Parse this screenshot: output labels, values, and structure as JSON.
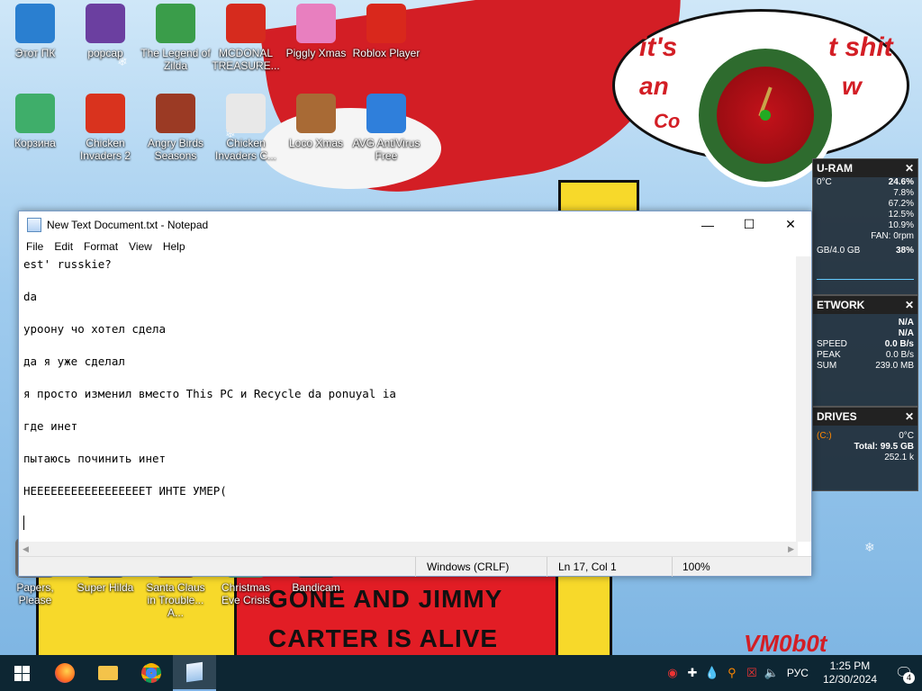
{
  "wallpaper": {
    "bubble_line1": "it's",
    "bubble_line2": "t shit",
    "bubble_line3": "an",
    "bubble_line4": "w",
    "bubble_line5": "Co",
    "shirt_line1": "GONE AND JIMMY",
    "shirt_line2": "CARTER IS ALIVE",
    "signature": "VM0b0t"
  },
  "desktop_icons": [
    {
      "label": "Этот ПК",
      "icon": "computer-icon"
    },
    {
      "label": "popcap",
      "icon": "popcap-icon"
    },
    {
      "label": "The Legend of Zilda",
      "icon": "zelda-game-icon"
    },
    {
      "label": "MCDONAL TREASURE...",
      "icon": "mcdonalds-game-icon"
    },
    {
      "label": "Piggly Xmas",
      "icon": "piggly-game-icon"
    },
    {
      "label": "Roblox Player",
      "icon": "roblox-icon"
    },
    {
      "label": "Корзина",
      "icon": "recycle-bin-icon"
    },
    {
      "label": "Chicken Invaders 2",
      "icon": "chicken-invaders-icon"
    },
    {
      "label": "Angry Birds Seasons",
      "icon": "angry-birds-icon"
    },
    {
      "label": "Chicken Invaders C...",
      "icon": "chicken-invaders-icon"
    },
    {
      "label": "Loco Xmas",
      "icon": "loco-game-icon"
    },
    {
      "label": "AVG AntiVirus Free",
      "icon": "avg-antivirus-icon"
    },
    {
      "label": "Papers, Please",
      "icon": "game-icon"
    },
    {
      "label": "Super Hilda",
      "icon": "game-icon"
    },
    {
      "label": "Santa Claus in Trouble... A...",
      "icon": "game-icon"
    },
    {
      "label": "Christmas Eve Crisis",
      "icon": "game-icon"
    },
    {
      "label": "Bandicam",
      "icon": "bandicam-icon"
    }
  ],
  "gadgets": {
    "ram": {
      "title": "U-RAM",
      "temp": "0°C",
      "cpu": "24.6%",
      "c1": "7.8%",
      "c2": "67.2%",
      "c3": "12.5%",
      "c4": "10.9%",
      "fan": "FAN: 0rpm",
      "mem": "GB/4.0 GB",
      "mem_pct": "38%"
    },
    "network": {
      "title": "ETWORK",
      "v1": "N/A",
      "v2": "N/A",
      "speed_label": "SPEED",
      "speed": "0.0 B/s",
      "peak_label": "PEAK",
      "peak": "0.0 B/s",
      "sum_label": "SUM",
      "sum": "239.0 MB"
    },
    "drives": {
      "title": "DRIVES",
      "drive": "(C:)",
      "temp": "0°C",
      "total": "Total: 99.5 GB",
      "used": "252.1 k"
    }
  },
  "notepad": {
    "title": "New Text Document.txt - Notepad",
    "menu": [
      "File",
      "Edit",
      "Format",
      "View",
      "Help"
    ],
    "lines": [
      "est' russkie?",
      "da",
      "уроону чо хотел сдела",
      "да я уже сделал",
      "я просто изменил вместо This PC и Recycle da ponuyal ia",
      "где инет",
      "пытаюсь починить инет",
      "НЕЕЕЕЕЕЕЕЕЕЕЕЕЕЕЕЕТ ИНТЕ УМЕР("
    ],
    "status": {
      "encoding": "Windows (CRLF)",
      "position": "Ln 17, Col 1",
      "zoom": "100%"
    }
  },
  "taskbar": {
    "language": "РУС",
    "time": "1:25 PM",
    "date": "12/30/2024",
    "notifications": "4"
  },
  "colors": {
    "taskbar": "#0d2633",
    "notepad_border": "#7a9cc6",
    "wallpaper_red": "#d31e25",
    "wallpaper_yellow": "#f7d92a"
  }
}
